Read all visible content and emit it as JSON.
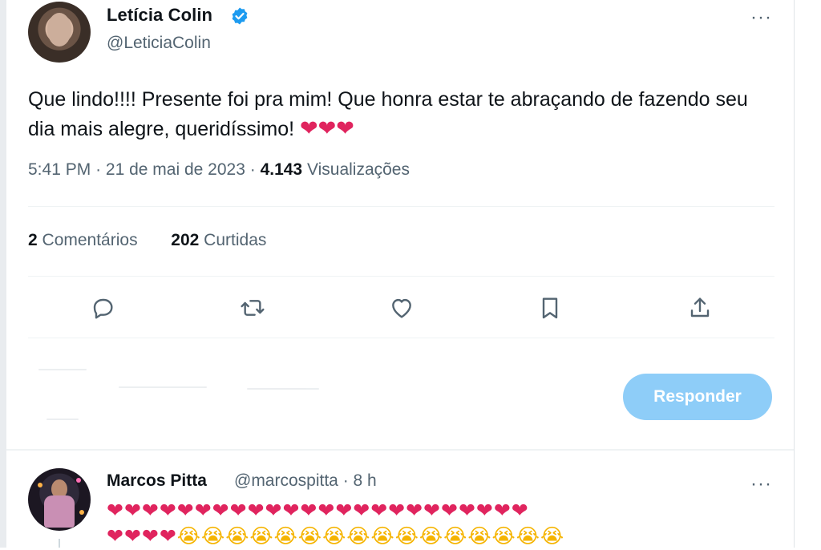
{
  "tweet": {
    "author_name": "Letícia Colin",
    "author_handle": "@LeticiaColin",
    "more_label": "···",
    "text": "Que lindo!!!! Presente foi pra mim! Que honra estar te abraçando de fazendo seu dia mais alegre, queridíssimo!",
    "text_hearts": "❤❤❤",
    "time": "5:41 PM",
    "date": "21 de mai de 2023",
    "separator": "·",
    "views_count": "4.143",
    "views_label": "Visualizações",
    "comments_count": "2",
    "comments_label": "Comentários",
    "likes_count": "202",
    "likes_label": "Curtidas"
  },
  "actions": [
    {
      "icon": "reply-icon"
    },
    {
      "icon": "retweet-icon"
    },
    {
      "icon": "like-icon"
    },
    {
      "icon": "bookmark-icon"
    },
    {
      "icon": "share-icon"
    }
  ],
  "composer": {
    "reply_button_label": "Responder"
  },
  "reply": {
    "name": "Marcos Pitta",
    "handle_time": "@marcospitta · 8 h",
    "more_label": "···",
    "line1": "❤❤❤❤❤❤❤❤❤❤❤❤❤❤❤❤❤❤❤❤❤❤❤❤",
    "line2_hearts": "❤❤❤❤",
    "line2_crying": "😭😭😭😭😭😭😭😭😭😭😭😭😭😭😭😭"
  },
  "colors": {
    "accent_blue": "#1d9bf0",
    "reply_button_disabled": "#8ecdf8",
    "heart_red": "#e0245e",
    "secondary_text": "#536471"
  }
}
